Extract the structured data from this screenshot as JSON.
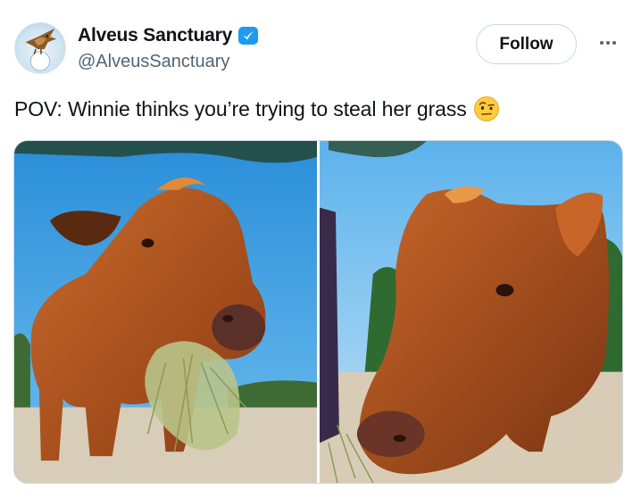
{
  "author": {
    "display_name": "Alveus Sanctuary",
    "handle": "@AlveusSanctuary",
    "verified": true,
    "verified_icon": "verified-badge-icon",
    "avatar_icon": "hawk-logo-avatar"
  },
  "actions": {
    "follow_label": "Follow",
    "more_icon": "more-horizontal-icon"
  },
  "tweet": {
    "text": "POV: Winnie thinks you’re trying to steal her grass",
    "emoji": "face-with-raised-eyebrow"
  },
  "media": [
    {
      "type": "photo",
      "subject": "cow-eating-hay"
    },
    {
      "type": "photo",
      "subject": "cow-closeup"
    }
  ],
  "colors": {
    "accent": "#1d9bf0",
    "text": "#0f1419",
    "secondary": "#536471",
    "sky": "#3f9ee0",
    "cow": "#b5531e"
  }
}
